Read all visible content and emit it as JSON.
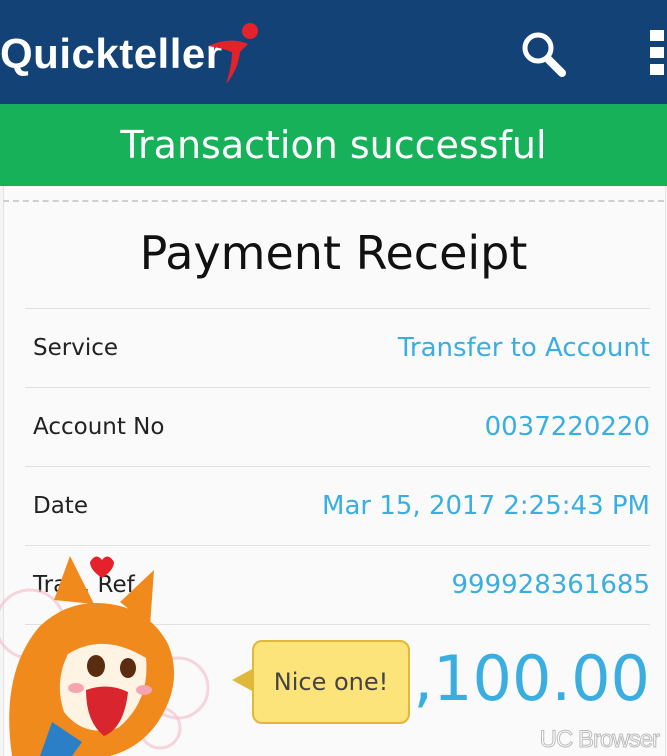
{
  "header": {
    "logo_text": "Quickteller",
    "background": "#134276",
    "logo_accent": "#e5222c",
    "icons": [
      "search-icon",
      "overflow-menu-icon"
    ]
  },
  "banner": {
    "text": "Transaction successful",
    "color": "#17b15a"
  },
  "receipt": {
    "title": "Payment Receipt",
    "rows": [
      {
        "label": "Service",
        "value": "Transfer to Account"
      },
      {
        "label": "Account No",
        "value": "0037220220"
      },
      {
        "label": "Date",
        "value": "Mar 15, 2017 2:25:43 PM"
      },
      {
        "label": "Tra… Ref...",
        "value": "999928361685"
      }
    ],
    "amount_visible": "0,100.00",
    "value_color": "#3aaee0"
  },
  "overlay": {
    "bubble_text": "Nice one!",
    "watermark": "UC Browser"
  }
}
